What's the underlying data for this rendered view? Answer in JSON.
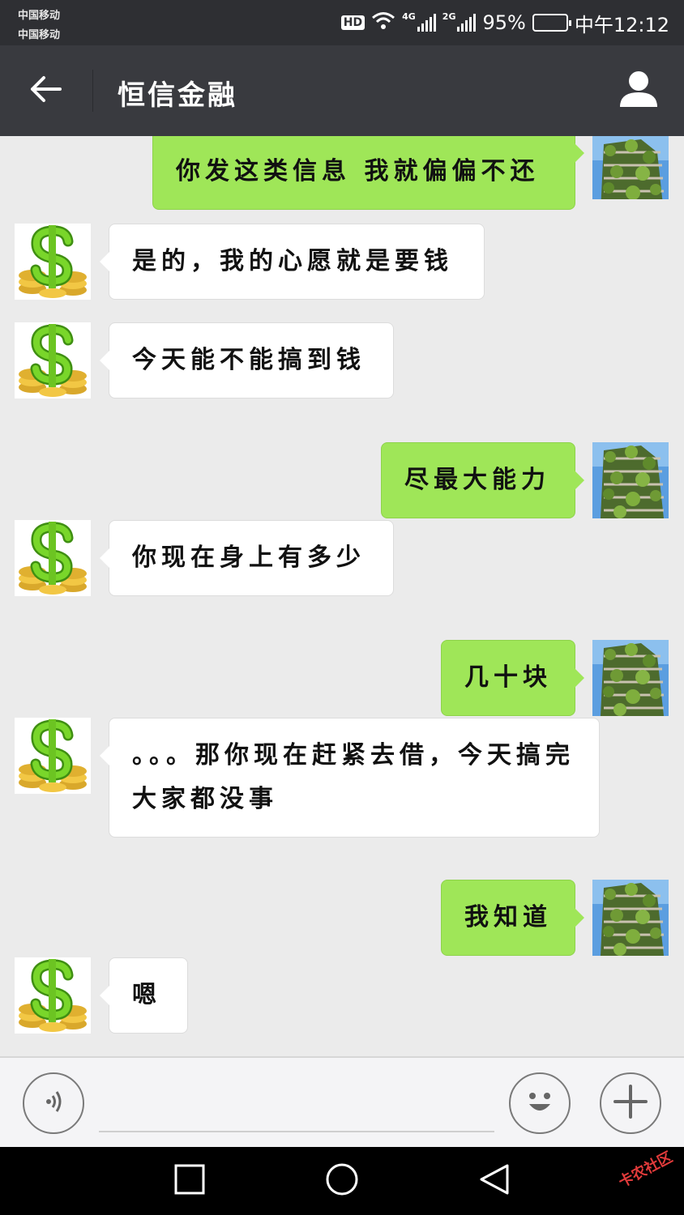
{
  "status_bar": {
    "carrier_1": "中国移动",
    "carrier_2": "中国移动",
    "hd_badge": "HD",
    "network_1": "4G",
    "network_2": "2G",
    "battery_text": "95%",
    "battery_level": 0.95,
    "time": "中午12:12"
  },
  "header": {
    "title": "恒信金融",
    "back_icon": "arrow-left-icon",
    "profile_icon": "person-icon"
  },
  "messages": [
    {
      "side": "out",
      "text": "你发这类信息 我就偏偏不还"
    },
    {
      "side": "in",
      "text": "是的，我的心愿就是要钱"
    },
    {
      "side": "in",
      "text": "今天能不能搞到钱"
    },
    {
      "side": "out",
      "text": "尽最大能力"
    },
    {
      "side": "in",
      "text": "你现在身上有多少"
    },
    {
      "side": "out",
      "text": "几十块"
    },
    {
      "side": "in",
      "text": "。。。那你现在赶紧去借，今天搞完大家都没事"
    },
    {
      "side": "out",
      "text": "我知道"
    },
    {
      "side": "in",
      "text": "嗯"
    }
  ],
  "input_bar": {
    "voice_icon": "voice-icon",
    "emoji_icon": "smiley-icon",
    "plus_icon": "plus-icon",
    "message_value": ""
  },
  "nav_bar": {
    "recents_icon": "square-icon",
    "home_icon": "circle-icon",
    "back_icon": "triangle-back-icon",
    "watermark": "卡农社区"
  },
  "colors": {
    "status_bar": "#2e2f33",
    "title_bar": "#393a3f",
    "chat_bg": "#ebebeb",
    "outgoing_bubble": "#9fe658",
    "incoming_bubble": "#ffffff"
  }
}
